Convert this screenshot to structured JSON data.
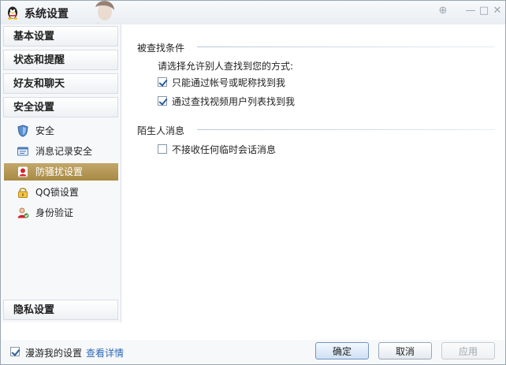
{
  "window": {
    "title": "系统设置"
  },
  "titlebar_buttons": {
    "help_icon": "help-icon",
    "min_icon": "minimize-icon",
    "max_icon": "maximize-icon",
    "close_icon": "close-icon"
  },
  "sidebar": {
    "groups": [
      {
        "label": "基本设置"
      },
      {
        "label": "状态和提醒"
      },
      {
        "label": "好友和聊天"
      },
      {
        "label": "安全设置"
      }
    ],
    "items": [
      {
        "label": "安全",
        "icon": "shield-icon"
      },
      {
        "label": "消息记录安全",
        "icon": "message-record-icon"
      },
      {
        "label": "防骚扰设置",
        "icon": "anti-harassment-icon",
        "active": true
      },
      {
        "label": "QQ锁设置",
        "icon": "lock-icon"
      },
      {
        "label": "身份验证",
        "icon": "identity-icon"
      }
    ],
    "bottom_group": {
      "label": "隐私设置"
    }
  },
  "main": {
    "sections": [
      {
        "title": "被查找条件",
        "prompt": "请选择允许别人查找到您的方式:",
        "options": [
          {
            "label": "只能通过帐号或昵称找到我",
            "checked": true
          },
          {
            "label": "通过查找视频用户列表找到我",
            "checked": true
          }
        ]
      },
      {
        "title": "陌生人消息",
        "options": [
          {
            "label": "不接收任何临时会话消息",
            "checked": false
          }
        ]
      }
    ]
  },
  "footer": {
    "roam_label": "漫游我的设置",
    "roam_checked": true,
    "details_link": "查看详情",
    "ok_label": "确定",
    "cancel_label": "取消",
    "apply_label": "应用"
  },
  "colors": {
    "accent_active": "#b09350",
    "link": "#2c69b5"
  }
}
